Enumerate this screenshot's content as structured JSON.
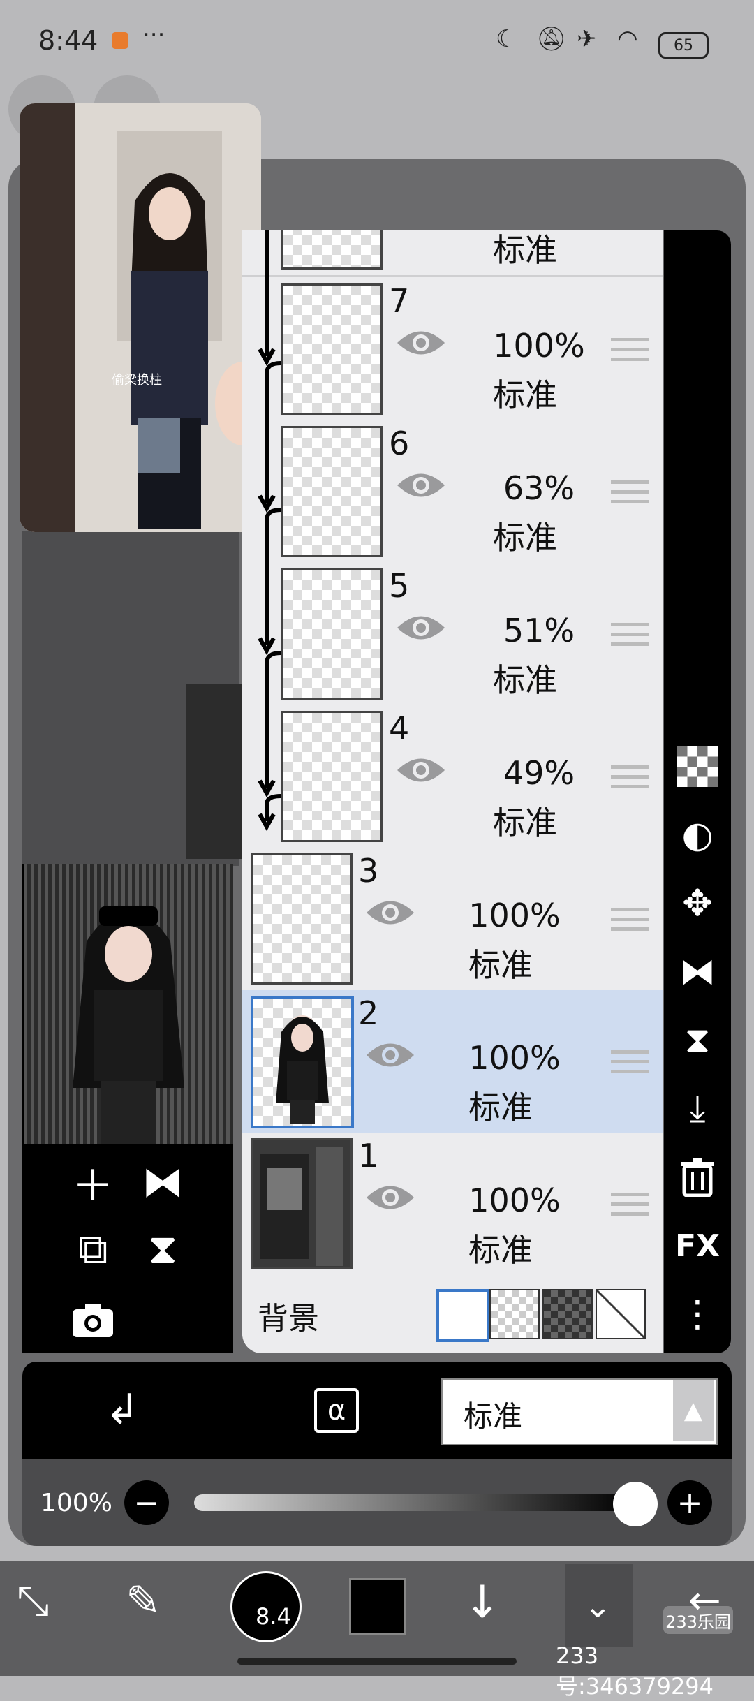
{
  "status": {
    "time": "8:44",
    "dots": "···",
    "battery": "65"
  },
  "layers": [
    {
      "num": "",
      "opacity": "",
      "mode": "标准"
    },
    {
      "num": "7",
      "opacity": "100%",
      "mode": "标准"
    },
    {
      "num": "6",
      "opacity": "63%",
      "mode": "标准"
    },
    {
      "num": "5",
      "opacity": "51%",
      "mode": "标准"
    },
    {
      "num": "4",
      "opacity": "49%",
      "mode": "标准"
    },
    {
      "num": "3",
      "opacity": "100%",
      "mode": "标准"
    },
    {
      "num": "2",
      "opacity": "100%",
      "mode": "标准",
      "selected": true
    },
    {
      "num": "1",
      "opacity": "100%",
      "mode": "标准"
    }
  ],
  "background": {
    "label": "背景"
  },
  "right_toolbar": {
    "fx": "FX"
  },
  "blend": {
    "mode": "标准"
  },
  "opacity": {
    "value": "100%",
    "level": 1.0
  },
  "brush": {
    "size": "8.4"
  },
  "video": {
    "caption": "偷梁换柱"
  },
  "watermark": "233号:346379294",
  "watermark_logo": "233乐园"
}
